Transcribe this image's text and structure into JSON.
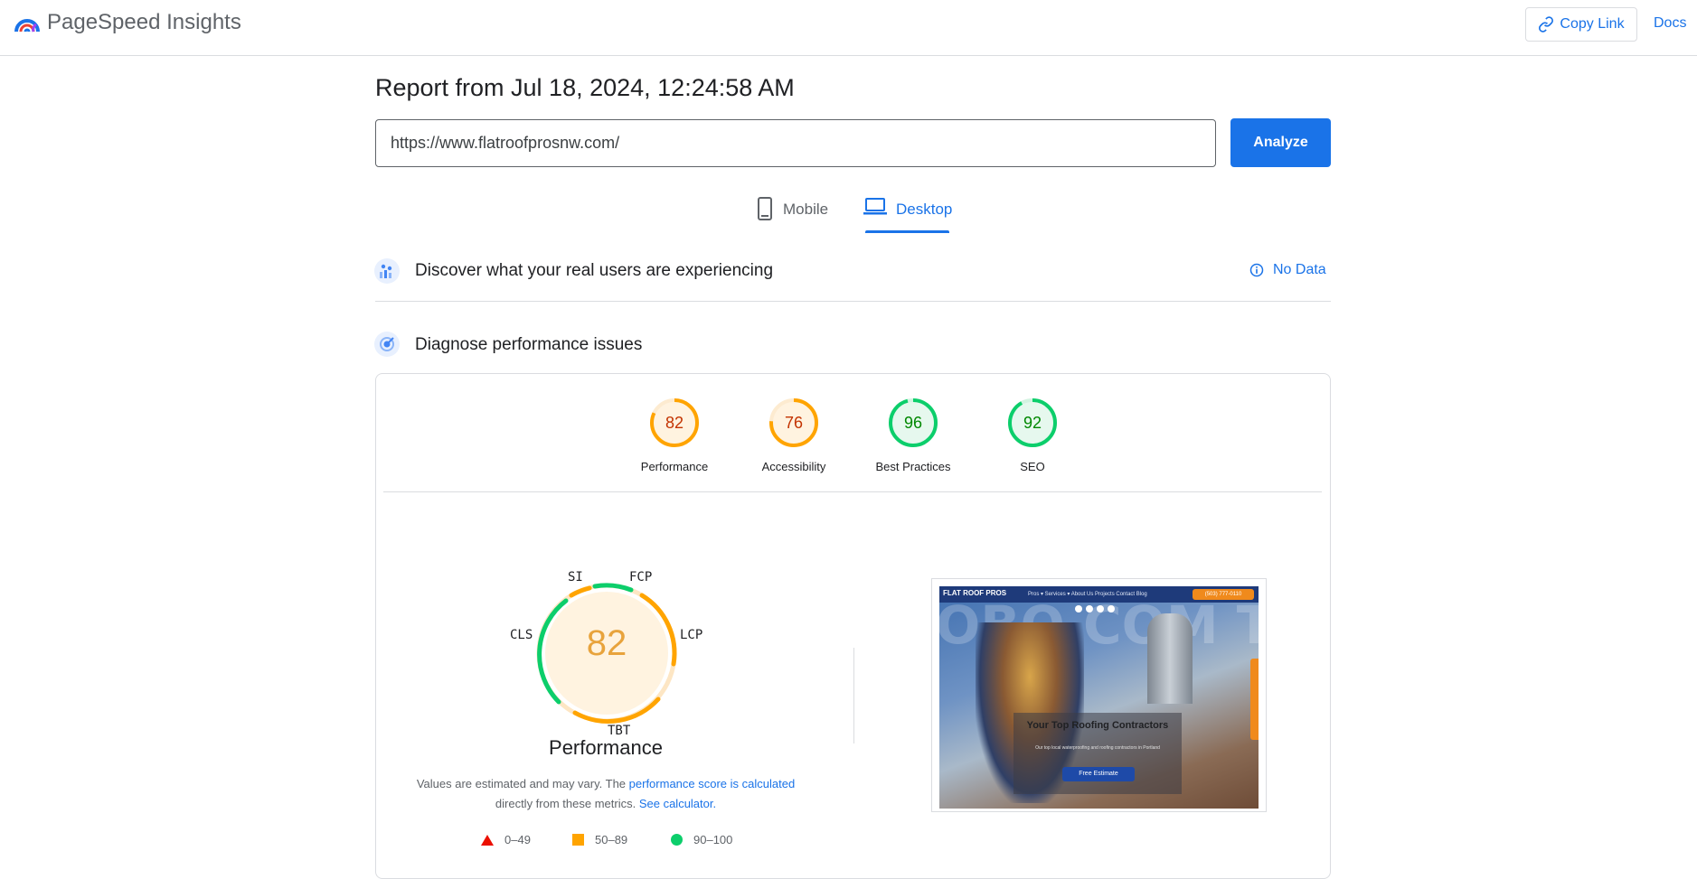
{
  "app": {
    "name": "PageSpeed Insights"
  },
  "header": {
    "copy_link_label": "Copy Link",
    "docs_label": "Docs"
  },
  "report": {
    "title": "Report from Jul 18, 2024, 12:24:58 AM",
    "url": "https://www.flatroofprosnw.com/",
    "analyze_label": "Analyze"
  },
  "tabs": [
    {
      "label": "Mobile",
      "icon": "smartphone-icon",
      "selected": false
    },
    {
      "label": "Desktop",
      "icon": "laptop-icon",
      "selected": true
    }
  ],
  "real_users": {
    "title": "Discover what your real users are experiencing",
    "status": "No Data"
  },
  "diagnose": {
    "title": "Diagnose performance issues"
  },
  "category_scores": [
    {
      "label": "Performance",
      "score": "82",
      "rating": "average"
    },
    {
      "label": "Accessibility",
      "score": "76",
      "rating": "average"
    },
    {
      "label": "Best Practices",
      "score": "96",
      "rating": "pass"
    },
    {
      "label": "SEO",
      "score": "92",
      "rating": "pass"
    }
  ],
  "performance": {
    "score": "82",
    "title": "Performance",
    "metrics": [
      "SI",
      "FCP",
      "LCP",
      "TBT",
      "CLS"
    ],
    "note_prefix": "Values are estimated and may vary. The ",
    "note_link1": "performance score is calculated",
    "note_middle": " directly from these metrics. ",
    "note_link2": "See calculator."
  },
  "legend": [
    {
      "range": "0–49",
      "shape": "triangle",
      "color": "#eb0f00"
    },
    {
      "range": "50–89",
      "shape": "square",
      "color": "#ffa400"
    },
    {
      "range": "90–100",
      "shape": "circle",
      "color": "#0cce6b"
    }
  ],
  "colors": {
    "accent": "#1a73e8",
    "average": "#ffa400",
    "average_text": "#c33300",
    "pass": "#0cce6b",
    "pass_text": "#008800"
  },
  "thumbnail": {
    "logo": "FLAT ROOF PROS",
    "nav": "Pros ▾   Services ▾   About Us   Projects   Contact   Blog",
    "phone": "(503) 777-0110",
    "heading": "Your Top Roofing Contractors",
    "subtext": "Our top local waterproofing and roofing contractors in Portland",
    "cta": "Free Estimate",
    "background_text": "OBO COM TLE TTLE"
  }
}
